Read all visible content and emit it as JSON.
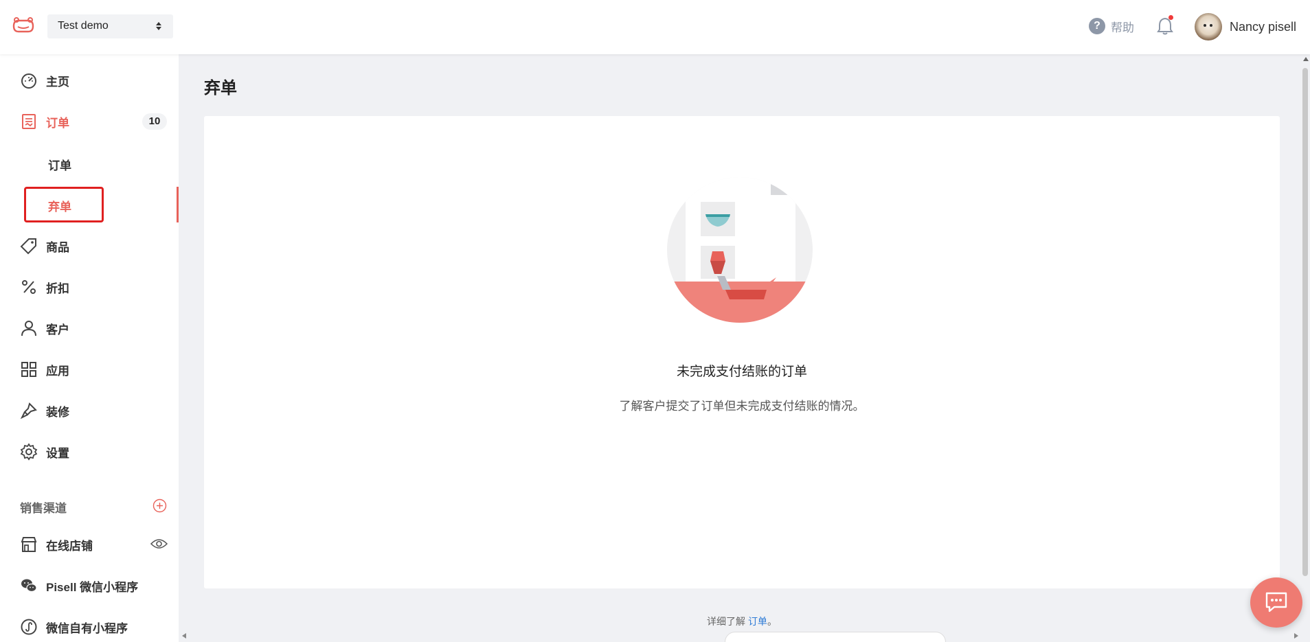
{
  "header": {
    "store_name": "Test demo",
    "help_label": "帮助",
    "user_name": "Nancy pisell",
    "has_notification": true
  },
  "sidebar": {
    "items": [
      {
        "label": "主页",
        "icon": "dashboard-icon"
      },
      {
        "label": "订单",
        "icon": "order-icon",
        "badge": "10",
        "active": true
      },
      {
        "label": "商品",
        "icon": "tag-icon"
      },
      {
        "label": "折扣",
        "icon": "percent-icon"
      },
      {
        "label": "客户",
        "icon": "user-icon"
      },
      {
        "label": "应用",
        "icon": "apps-icon"
      },
      {
        "label": "装修",
        "icon": "brush-icon"
      },
      {
        "label": "设置",
        "icon": "gear-icon"
      }
    ],
    "order_sub_items": [
      {
        "label": "订单"
      },
      {
        "label": "弃单",
        "current": true
      }
    ],
    "sales_channels_title": "销售渠道",
    "channels": [
      {
        "label": "在线店铺",
        "icon": "store-icon"
      },
      {
        "label": "Pisell 微信小程序",
        "icon": "wechat-icon"
      },
      {
        "label": "微信自有小程序",
        "icon": "mini-program-icon"
      }
    ]
  },
  "main": {
    "page_title": "弃单",
    "empty_title": "未完成支付结账的订单",
    "empty_description": "了解客户提交了订单但未完成支付结账的情况。",
    "learn_more_prefix": "详细了解 ",
    "learn_more_link": "订单",
    "learn_more_suffix": "。"
  },
  "colors": {
    "accent": "#e8625a",
    "highlight_box": "#e02020",
    "link": "#2e7bd6",
    "background": "#f0f1f4"
  }
}
